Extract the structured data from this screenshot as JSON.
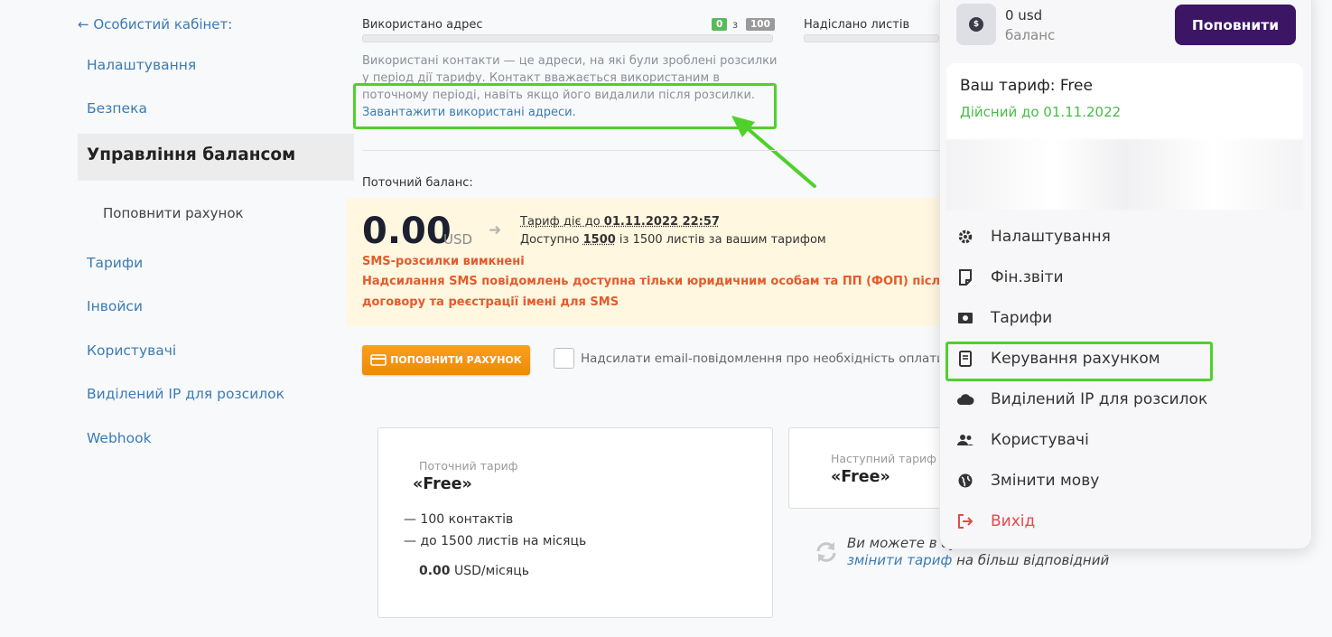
{
  "sidebar": {
    "back_label": "← Особистий кабінет:",
    "items": [
      {
        "label": "Налаштування"
      },
      {
        "label": "Безпека"
      },
      {
        "label": "Управління балансом"
      },
      {
        "label": "Поповнити рахунок"
      },
      {
        "label": "Тарифи"
      },
      {
        "label": "Інвойси"
      },
      {
        "label": "Користувачі"
      },
      {
        "label": "Виділений IP для розсилок"
      },
      {
        "label": "Webhook"
      }
    ]
  },
  "usage": {
    "addresses_label": "Використано адрес",
    "used": "0",
    "of": "з",
    "total": "100",
    "sent_label": "Надіслано листів",
    "description": "Використані контакти — це адреси, на які були зроблені розсилки у період дії тарифу. Контакт вважається використаним в поточному періоді, навіть якщо його видалили після розсилки.",
    "download_link": "Завантажити використані адреси."
  },
  "balance": {
    "current_label": "Поточний баланс:",
    "amount": "0.00",
    "currency": "USD",
    "tariff_valid_prefix": "Тариф діє до ",
    "tariff_valid_date": "01.11.2022 22:57",
    "available_prefix": "Доступно ",
    "available_count": "1500",
    "available_suffix": " із 1500 листів за вашим тарифом",
    "sms_off": "SMS-розсилки вимкнені",
    "sms_info_line1": "Надсилання SMS повідомлень доступна тільки юридичним особам та ПП (ФОП) після поповн",
    "sms_info_line2": "договору та реєстрації імені для SMS"
  },
  "actions": {
    "topup_button": "ПОПОВНИТИ РАХУНОК",
    "email_notify_label": "Надсилати email-повідомлення про необхідність оплати"
  },
  "current_tariff": {
    "caption": "Поточний тариф",
    "name": "«Free»",
    "features": [
      "— 100 контактів",
      "— до 1500 листів на місяць"
    ],
    "price_amount": "0.00",
    "price_unit": " USD/місяць"
  },
  "next_tariff": {
    "caption": "Наступний тариф",
    "name": "«Free»"
  },
  "change_info": {
    "line1": "Ви можете в бу",
    "link": "змінити тариф",
    "line2_suffix": " на більш відповідний"
  },
  "dropdown": {
    "balance_value": "0 usd",
    "balance_label": "баланс",
    "topup_button": "Поповнити",
    "tariff_title": "Ваш тариф: Free",
    "valid_until": "Дійсний до 01.11.2022",
    "menu": [
      {
        "label": "Налаштування",
        "icon": "gear-icon"
      },
      {
        "label": "Фін.звіти",
        "icon": "document-icon"
      },
      {
        "label": "Тарифи",
        "icon": "money-icon"
      },
      {
        "label": "Керування рахунком",
        "icon": "receipt-icon"
      },
      {
        "label": "Виділений IP для розсилок",
        "icon": "cloud-icon"
      },
      {
        "label": "Користувачі",
        "icon": "users-icon"
      },
      {
        "label": "Змінити мову",
        "icon": "globe-icon"
      },
      {
        "label": "Вихід",
        "icon": "logout-icon"
      }
    ]
  },
  "colors": {
    "highlight": "#4fd12c",
    "accent_purple": "#3c1665",
    "link": "#3b7bb6",
    "warning_bg": "#fff7e0",
    "orange": "#f39514"
  }
}
